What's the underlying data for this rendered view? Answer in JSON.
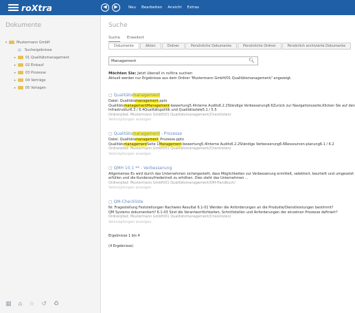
{
  "app": {
    "title": "roXtra",
    "menu": [
      "Neu",
      "Bearbeiten",
      "Ansicht",
      "Extras"
    ]
  },
  "sidebar": {
    "title": "Dokumente",
    "items": [
      {
        "label": "Mustermann GmbH",
        "level": 0,
        "toggle": "▾",
        "icon": "folder"
      },
      {
        "label": "Suchergebnisse",
        "level": 1,
        "toggle": "",
        "icon": "results"
      },
      {
        "label": "01 Qualitätsmanagement",
        "level": 1,
        "toggle": "▸",
        "icon": "folder"
      },
      {
        "label": "02 Einkauf",
        "level": 1,
        "toggle": "▸",
        "icon": "folder"
      },
      {
        "label": "03 Prozesse",
        "level": 1,
        "toggle": "▸",
        "icon": "folder"
      },
      {
        "label": "04 Verträge",
        "level": 1,
        "toggle": "▸",
        "icon": "folder"
      },
      {
        "label": "05 Vorlagen",
        "level": 1,
        "toggle": "▸",
        "icon": "folder"
      }
    ]
  },
  "search": {
    "title": "Suche",
    "subtabs": [
      "Suche",
      "Erweitert"
    ],
    "tabs": [
      "Dokumente",
      "Akten",
      "Ordner",
      "Persönliche Dokumente",
      "Persönliche Ordner",
      "Persönlich archivierte Dokumente"
    ],
    "query": "Management",
    "hint_bold": "Möchten Sie:",
    "hint_rest": "Jetzt überall in roXtra suchen",
    "hint2": "Aktuell werden nur Ergebnisse aus dem Ordner 'Mustermann GmbH/01 Qualitätsmanagement/' angezeigt."
  },
  "results": [
    {
      "title": [
        [
          "Qualitäts",
          false
        ],
        [
          "management",
          true
        ]
      ],
      "lines": [
        [
          [
            "Datei: Qualitäts",
            false
          ],
          [
            "management",
            true
          ],
          [
            ".pptx",
            false
          ]
        ],
        [
          [
            "Qualitäts",
            false
          ],
          [
            "managementManagement",
            true
          ],
          [
            "-bewertung5.4Interne Audits6.2.2Ständige Verbesserung6.6Zurück zur Navigationsseite,Klicken Sie auf den gewünschten",
            false
          ]
        ],
        [
          [
            "Infrastruktur6.3 / 6.4Qualitätspolitik und Qualitätsziele5.1 / 5.5",
            false
          ]
        ]
      ],
      "source": "Ordnerpfad: Mustermann GmbH/01 Qualitätsmanagement/Checklisten/",
      "link": "Verknüpfungen anzeigen"
    },
    {
      "title": [
        [
          "Qualitäts",
          false
        ],
        [
          "management",
          true
        ],
        [
          " - Prozesse",
          false
        ]
      ],
      "lines": [
        [
          [
            "Datei: Qualitäts",
            false
          ],
          [
            "management",
            true
          ],
          [
            "_Prozesse.pptx",
            false
          ]
        ],
        [
          [
            "Qualitäts",
            false
          ],
          [
            "management",
            true
          ],
          [
            "Seite 1",
            false
          ],
          [
            "Management",
            true
          ],
          [
            "-bewertung5.4Interne Audits6.2.2Ständige Verbesserung6.6Ressourcen-planung6.1 / 6.2",
            false
          ]
        ]
      ],
      "source": "Ordnerpfad: Mustermann GmbH/01 Qualitätsmanagement/Checklisten/",
      "link": "Verknüpfungen anzeigen"
    },
    {
      "title": [
        [
          "QMH 10.1 ** - Verbesserung",
          false
        ]
      ],
      "lines": [
        [
          [
            "Allgemeines Es wird durch das Unternehmen sichergestellt, dass Möglichkeiten zur Verbesserung ermittelt, selektiert, beurteilt und umgesetzt werden,",
            false
          ]
        ],
        [
          [
            "erfüllen und die Kundenzufriedenheit zu erhöhen. Dies steht das Unternehmen ...",
            false
          ]
        ]
      ],
      "source": "Ordnerpfad: Mustermann GmbH/01 Qualitätsmanagement/QM-Handbuch/",
      "link": "Verknüpfungen anzeigen"
    },
    {
      "title": [
        [
          "QM-Checkliste",
          false
        ]
      ],
      "lines": [
        [
          [
            "Nr. Fragestellung Feststellungen Nachweis Resultat 6.1-01 Werden die Anforderungen an die Produkte/Dienstleistungen bestimmt?",
            false
          ]
        ],
        [
          [
            "QM Systems dokumentiert? 6.1-03 Sind die Verantwortlichkeiten, Schnittstellen und Anforderungen der einzelnen Prozesse definiert?",
            false
          ]
        ]
      ],
      "source": "Ordnerpfad: Mustermann GmbH/01 Qualitätsmanagement/Checklisten/",
      "link": "Verknüpfungen anzeigen"
    }
  ],
  "paging": {
    "range": "Ergebnisse 1 bis 4",
    "total": "(4 Ergebnisse)"
  }
}
